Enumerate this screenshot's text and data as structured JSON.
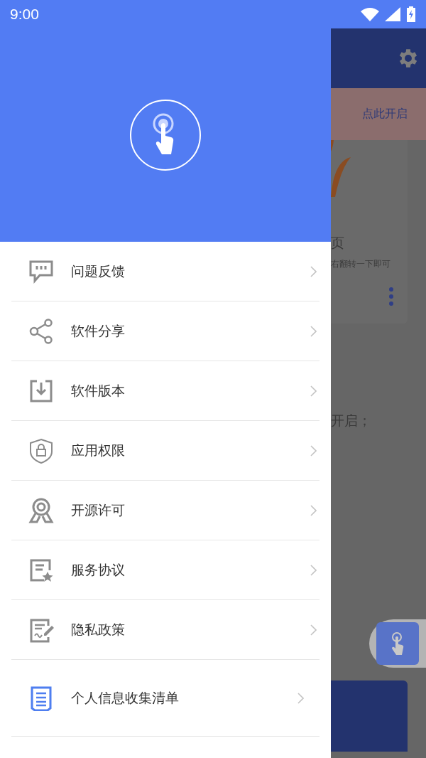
{
  "status_bar": {
    "time": "9:00"
  },
  "drawer": {
    "items": [
      {
        "label": "问题反馈"
      },
      {
        "label": "软件分享"
      },
      {
        "label": "软件版本"
      },
      {
        "label": "应用权限"
      },
      {
        "label": "开源许可"
      },
      {
        "label": "服务协议"
      },
      {
        "label": "隐私政策"
      },
      {
        "label": "个人信息收集清单"
      }
    ]
  },
  "background_app": {
    "banner_action": "点此开启",
    "card_title": "页",
    "card_hint": "右翻转一下即可",
    "step_text": "开启；"
  }
}
